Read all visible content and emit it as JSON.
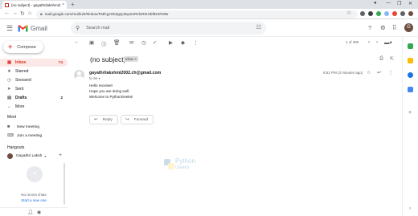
{
  "browser": {
    "tab_title": "(no subject) - gayathrilakshmi2002.ch@gmail.com",
    "tab_close": "×",
    "new_tab": "+",
    "url": "mail.google.com/mail/u/0/#inbox/FMfcgzGkZgQJkqvsXRzlvRtKXbftDXFMW",
    "window_controls": [
      "●",
      "—",
      "❐",
      "✕"
    ]
  },
  "gmail": {
    "brand": "Gmail",
    "search_placeholder": "Search mail",
    "avatar_letter": "G"
  },
  "sidebar": {
    "compose": "Compose",
    "items": [
      {
        "label": "Inbox",
        "count": "74",
        "icon": "inbox-icon",
        "glyph": "▣"
      },
      {
        "label": "Starred",
        "count": "",
        "icon": "star-icon",
        "glyph": "★"
      },
      {
        "label": "Snoozed",
        "count": "",
        "icon": "clock-icon",
        "glyph": "◷"
      },
      {
        "label": "Sent",
        "count": "",
        "icon": "send-icon",
        "glyph": "➤"
      },
      {
        "label": "Drafts",
        "count": "2",
        "icon": "draft-icon",
        "glyph": "▤"
      },
      {
        "label": "More",
        "count": "",
        "icon": "chevron-down-icon",
        "glyph": "⌄"
      }
    ],
    "meet_header": "Meet",
    "meet_items": [
      {
        "label": "New meeting",
        "icon": "video-icon",
        "glyph": "■"
      },
      {
        "label": "Join a meeting",
        "icon": "keyboard-icon",
        "glyph": "⌨"
      }
    ],
    "hangouts_header": "Hangouts",
    "hangouts_user": "Gayathri Laksh",
    "no_recent": "No recent chats",
    "start_new": "Start a new one"
  },
  "toolbar": {
    "pager": "1 of 290"
  },
  "message": {
    "subject": "(no subject)",
    "label": "Inbox ×",
    "sender": "gayathrilakshmi2002.ch@gmail.com",
    "to": "to me ▾",
    "time": "6:51 PM (3 minutes ago)",
    "body": [
      "Hello receiver!",
      "Hope you are doing well.",
      "Welcome to PythonGeeks!"
    ],
    "reply": "Reply",
    "forward": "Forward"
  },
  "watermark": {
    "line1": "Python",
    "line2": "Geeks"
  },
  "colors": {
    "accent_red": "#d93025",
    "link_blue": "#1a73e8",
    "active_bg": "#fce8e6"
  }
}
